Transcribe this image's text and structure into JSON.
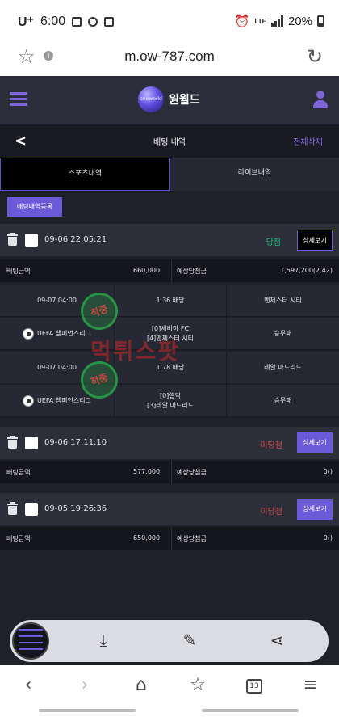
{
  "statusbar": {
    "carrier": "U⁺",
    "time": "6:00",
    "network": "LTE",
    "battery": "20%"
  },
  "browser": {
    "url": "m.ow-787.com",
    "tabs_count": "13"
  },
  "site": {
    "logo_text": "원월드",
    "logo_small": "oneworld"
  },
  "page": {
    "title": "배팅 내역",
    "delete_all": "전체삭제",
    "back": "<"
  },
  "tabs": [
    {
      "label": "스포츠내역",
      "active": true
    },
    {
      "label": "라이브내역",
      "active": false
    }
  ],
  "register_button": "배팅내역등록",
  "labels": {
    "bet_amount": "배팅금액",
    "expected_win": "예상당첨금",
    "detail": "상세보기"
  },
  "bets": [
    {
      "datetime": "09-06 22:05:21",
      "status": "당첨",
      "amount": "660,000",
      "expected": "1,597,200(2.42)",
      "matches": [
        {
          "time": "09-07 04:00",
          "odds": "1.36 배당",
          "pick": "맨체스터 시티",
          "league": "UEFA 챔피언스리그",
          "teams_home": "[0]세비야 FC",
          "teams_away": "[4]맨체스터 시티",
          "market": "승무패",
          "stamp": "적중"
        },
        {
          "time": "09-07 04:00",
          "odds": "1.78 배당",
          "pick": "레알 마드리드",
          "league": "UEFA 챔피언스리그",
          "teams_home": "[0]셀틱",
          "teams_away": "[3]레알 마드리드",
          "market": "승무패",
          "stamp": "적중"
        }
      ]
    },
    {
      "datetime": "09-06 17:11:10",
      "status": "미당첨",
      "amount": "577,000",
      "expected": "0()"
    },
    {
      "datetime": "09-05 19:26:36",
      "status": "미당첨",
      "amount": "650,000",
      "expected": "0()"
    }
  ],
  "watermark": "먹튀스팟",
  "colors": {
    "accent": "#6d5ad8",
    "win": "#19c079",
    "lose": "#d24b4b",
    "bg": "#1f2129"
  }
}
